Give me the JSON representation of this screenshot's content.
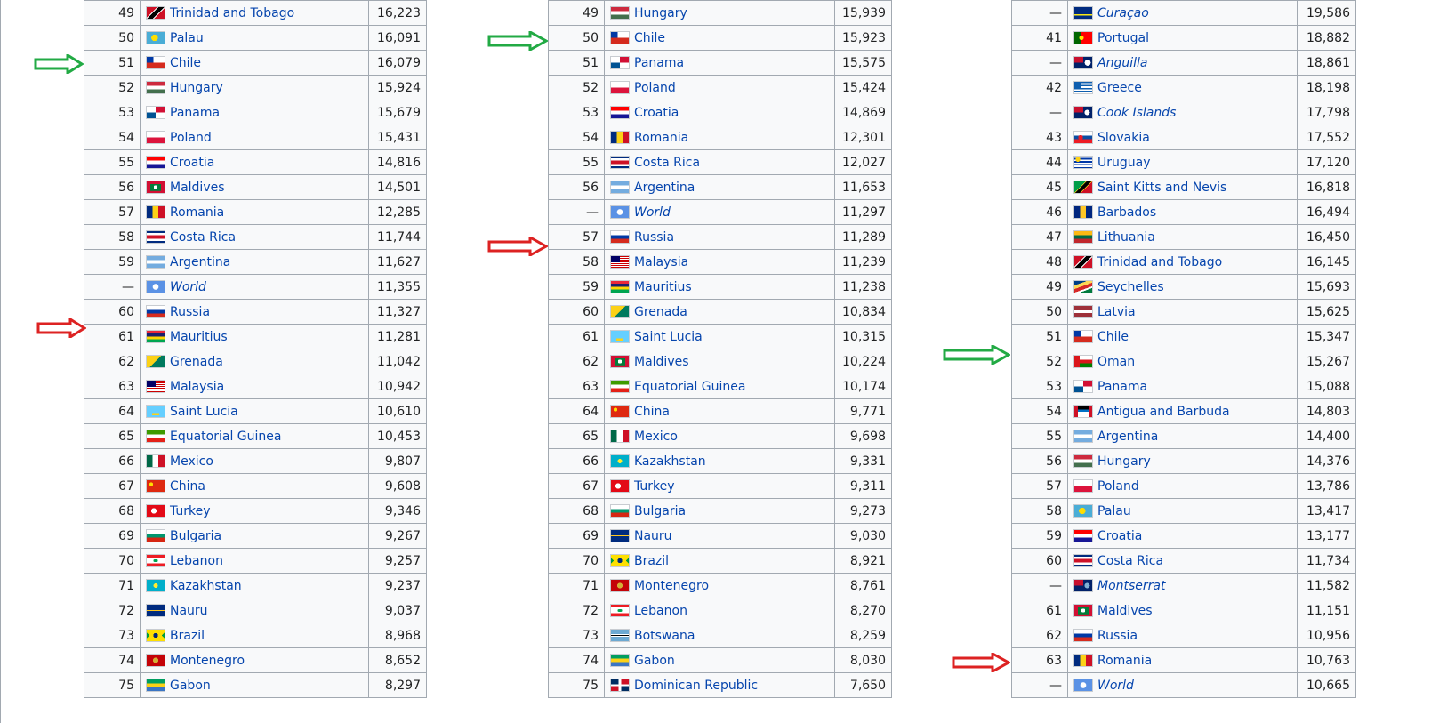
{
  "tables": [
    {
      "rows": [
        {
          "rank": "49",
          "country": "Trinidad and Tobago",
          "value": "16,223",
          "flag": "trinidad-flag-icon"
        },
        {
          "rank": "50",
          "country": "Palau",
          "value": "16,091",
          "flag": "palau-flag-icon"
        },
        {
          "rank": "51",
          "country": "Chile",
          "value": "16,079",
          "flag": "chile-flag-icon"
        },
        {
          "rank": "52",
          "country": "Hungary",
          "value": "15,924",
          "flag": "hungary-flag-icon"
        },
        {
          "rank": "53",
          "country": "Panama",
          "value": "15,679",
          "flag": "panama-flag-icon"
        },
        {
          "rank": "54",
          "country": "Poland",
          "value": "15,431",
          "flag": "poland-flag-icon"
        },
        {
          "rank": "55",
          "country": "Croatia",
          "value": "14,816",
          "flag": "croatia-flag-icon"
        },
        {
          "rank": "56",
          "country": "Maldives",
          "value": "14,501",
          "flag": "maldives-flag-icon"
        },
        {
          "rank": "57",
          "country": "Romania",
          "value": "12,285",
          "flag": "romania-flag-icon"
        },
        {
          "rank": "58",
          "country": "Costa Rica",
          "value": "11,744",
          "flag": "costa-rica-flag-icon"
        },
        {
          "rank": "59",
          "country": "Argentina",
          "value": "11,627",
          "flag": "argentina-flag-icon"
        },
        {
          "rank": "—",
          "country": "World",
          "value": "11,355",
          "flag": "un-flag-icon",
          "italic": true
        },
        {
          "rank": "60",
          "country": "Russia",
          "value": "11,327",
          "flag": "russia-flag-icon"
        },
        {
          "rank": "61",
          "country": "Mauritius",
          "value": "11,281",
          "flag": "mauritius-flag-icon"
        },
        {
          "rank": "62",
          "country": "Grenada",
          "value": "11,042",
          "flag": "grenada-flag-icon"
        },
        {
          "rank": "63",
          "country": "Malaysia",
          "value": "10,942",
          "flag": "malaysia-flag-icon"
        },
        {
          "rank": "64",
          "country": "Saint Lucia",
          "value": "10,610",
          "flag": "saint-lucia-flag-icon"
        },
        {
          "rank": "65",
          "country": "Equatorial Guinea",
          "value": "10,453",
          "flag": "equatorial-guinea-flag-icon"
        },
        {
          "rank": "66",
          "country": "Mexico",
          "value": "9,807",
          "flag": "mexico-flag-icon"
        },
        {
          "rank": "67",
          "country": "China",
          "value": "9,608",
          "flag": "china-flag-icon"
        },
        {
          "rank": "68",
          "country": "Turkey",
          "value": "9,346",
          "flag": "turkey-flag-icon"
        },
        {
          "rank": "69",
          "country": "Bulgaria",
          "value": "9,267",
          "flag": "bulgaria-flag-icon"
        },
        {
          "rank": "70",
          "country": "Lebanon",
          "value": "9,257",
          "flag": "lebanon-flag-icon"
        },
        {
          "rank": "71",
          "country": "Kazakhstan",
          "value": "9,237",
          "flag": "kazakhstan-flag-icon"
        },
        {
          "rank": "72",
          "country": "Nauru",
          "value": "9,037",
          "flag": "nauru-flag-icon"
        },
        {
          "rank": "73",
          "country": "Brazil",
          "value": "8,968",
          "flag": "brazil-flag-icon"
        },
        {
          "rank": "74",
          "country": "Montenegro",
          "value": "8,652",
          "flag": "montenegro-flag-icon"
        },
        {
          "rank": "75",
          "country": "Gabon",
          "value": "8,297",
          "flag": "gabon-flag-icon"
        }
      ]
    },
    {
      "rows": [
        {
          "rank": "49",
          "country": "Hungary",
          "value": "15,939",
          "flag": "hungary-flag-icon"
        },
        {
          "rank": "50",
          "country": "Chile",
          "value": "15,923",
          "flag": "chile-flag-icon"
        },
        {
          "rank": "51",
          "country": "Panama",
          "value": "15,575",
          "flag": "panama-flag-icon"
        },
        {
          "rank": "52",
          "country": "Poland",
          "value": "15,424",
          "flag": "poland-flag-icon"
        },
        {
          "rank": "53",
          "country": "Croatia",
          "value": "14,869",
          "flag": "croatia-flag-icon"
        },
        {
          "rank": "54",
          "country": "Romania",
          "value": "12,301",
          "flag": "romania-flag-icon"
        },
        {
          "rank": "55",
          "country": "Costa Rica",
          "value": "12,027",
          "flag": "costa-rica-flag-icon"
        },
        {
          "rank": "56",
          "country": "Argentina",
          "value": "11,653",
          "flag": "argentina-flag-icon"
        },
        {
          "rank": "—",
          "country": "World",
          "value": "11,297",
          "flag": "un-flag-icon",
          "italic": true
        },
        {
          "rank": "57",
          "country": "Russia",
          "value": "11,289",
          "flag": "russia-flag-icon"
        },
        {
          "rank": "58",
          "country": "Malaysia",
          "value": "11,239",
          "flag": "malaysia-flag-icon"
        },
        {
          "rank": "59",
          "country": "Mauritius",
          "value": "11,238",
          "flag": "mauritius-flag-icon"
        },
        {
          "rank": "60",
          "country": "Grenada",
          "value": "10,834",
          "flag": "grenada-flag-icon"
        },
        {
          "rank": "61",
          "country": "Saint Lucia",
          "value": "10,315",
          "flag": "saint-lucia-flag-icon"
        },
        {
          "rank": "62",
          "country": "Maldives",
          "value": "10,224",
          "flag": "maldives-flag-icon"
        },
        {
          "rank": "63",
          "country": "Equatorial Guinea",
          "value": "10,174",
          "flag": "equatorial-guinea-flag-icon"
        },
        {
          "rank": "64",
          "country": "China",
          "value": "9,771",
          "flag": "china-flag-icon"
        },
        {
          "rank": "65",
          "country": "Mexico",
          "value": "9,698",
          "flag": "mexico-flag-icon"
        },
        {
          "rank": "66",
          "country": "Kazakhstan",
          "value": "9,331",
          "flag": "kazakhstan-flag-icon"
        },
        {
          "rank": "67",
          "country": "Turkey",
          "value": "9,311",
          "flag": "turkey-flag-icon"
        },
        {
          "rank": "68",
          "country": "Bulgaria",
          "value": "9,273",
          "flag": "bulgaria-flag-icon"
        },
        {
          "rank": "69",
          "country": "Nauru",
          "value": "9,030",
          "flag": "nauru-flag-icon"
        },
        {
          "rank": "70",
          "country": "Brazil",
          "value": "8,921",
          "flag": "brazil-flag-icon"
        },
        {
          "rank": "71",
          "country": "Montenegro",
          "value": "8,761",
          "flag": "montenegro-flag-icon"
        },
        {
          "rank": "72",
          "country": "Lebanon",
          "value": "8,270",
          "flag": "lebanon-flag-icon"
        },
        {
          "rank": "73",
          "country": "Botswana",
          "value": "8,259",
          "flag": "botswana-flag-icon"
        },
        {
          "rank": "74",
          "country": "Gabon",
          "value": "8,030",
          "flag": "gabon-flag-icon"
        },
        {
          "rank": "75",
          "country": "Dominican Republic",
          "value": "7,650",
          "flag": "dominican-republic-flag-icon"
        }
      ]
    },
    {
      "rows": [
        {
          "rank": "—",
          "country": "Curaçao",
          "value": "19,586",
          "flag": "curacao-flag-icon",
          "italic": true
        },
        {
          "rank": "41",
          "country": "Portugal",
          "value": "18,882",
          "flag": "portugal-flag-icon"
        },
        {
          "rank": "—",
          "country": "Anguilla",
          "value": "18,861",
          "flag": "anguilla-flag-icon",
          "italic": true
        },
        {
          "rank": "42",
          "country": "Greece",
          "value": "18,198",
          "flag": "greece-flag-icon"
        },
        {
          "rank": "—",
          "country": "Cook Islands",
          "value": "17,798",
          "flag": "cook-islands-flag-icon",
          "italic": true
        },
        {
          "rank": "43",
          "country": "Slovakia",
          "value": "17,552",
          "flag": "slovakia-flag-icon"
        },
        {
          "rank": "44",
          "country": "Uruguay",
          "value": "17,120",
          "flag": "uruguay-flag-icon"
        },
        {
          "rank": "45",
          "country": "Saint Kitts and Nevis",
          "value": "16,818",
          "flag": "saint-kitts-flag-icon"
        },
        {
          "rank": "46",
          "country": "Barbados",
          "value": "16,494",
          "flag": "barbados-flag-icon"
        },
        {
          "rank": "47",
          "country": "Lithuania",
          "value": "16,450",
          "flag": "lithuania-flag-icon"
        },
        {
          "rank": "48",
          "country": "Trinidad and Tobago",
          "value": "16,145",
          "flag": "trinidad-flag-icon"
        },
        {
          "rank": "49",
          "country": "Seychelles",
          "value": "15,693",
          "flag": "seychelles-flag-icon"
        },
        {
          "rank": "50",
          "country": "Latvia",
          "value": "15,625",
          "flag": "latvia-flag-icon"
        },
        {
          "rank": "51",
          "country": "Chile",
          "value": "15,347",
          "flag": "chile-flag-icon"
        },
        {
          "rank": "52",
          "country": "Oman",
          "value": "15,267",
          "flag": "oman-flag-icon"
        },
        {
          "rank": "53",
          "country": "Panama",
          "value": "15,088",
          "flag": "panama-flag-icon"
        },
        {
          "rank": "54",
          "country": "Antigua and Barbuda",
          "value": "14,803",
          "flag": "antigua-flag-icon"
        },
        {
          "rank": "55",
          "country": "Argentina",
          "value": "14,400",
          "flag": "argentina-flag-icon"
        },
        {
          "rank": "56",
          "country": "Hungary",
          "value": "14,376",
          "flag": "hungary-flag-icon"
        },
        {
          "rank": "57",
          "country": "Poland",
          "value": "13,786",
          "flag": "poland-flag-icon"
        },
        {
          "rank": "58",
          "country": "Palau",
          "value": "13,417",
          "flag": "palau-flag-icon"
        },
        {
          "rank": "59",
          "country": "Croatia",
          "value": "13,177",
          "flag": "croatia-flag-icon"
        },
        {
          "rank": "60",
          "country": "Costa Rica",
          "value": "11,734",
          "flag": "costa-rica-flag-icon"
        },
        {
          "rank": "—",
          "country": "Montserrat",
          "value": "11,582",
          "flag": "montserrat-flag-icon",
          "italic": true
        },
        {
          "rank": "61",
          "country": "Maldives",
          "value": "11,151",
          "flag": "maldives-flag-icon"
        },
        {
          "rank": "62",
          "country": "Russia",
          "value": "10,956",
          "flag": "russia-flag-icon"
        },
        {
          "rank": "63",
          "country": "Romania",
          "value": "10,763",
          "flag": "romania-flag-icon"
        },
        {
          "rank": "—",
          "country": "World",
          "value": "10,665",
          "flag": "un-flag-icon",
          "italic": true
        }
      ]
    }
  ],
  "annotations": {
    "chile_arrow_color": "#22aa44",
    "russia_arrow_color": "#dd2222",
    "link_color": "#0645ad",
    "border_color": "#a2a9b1",
    "cell_bg": "#f8f9fa"
  }
}
